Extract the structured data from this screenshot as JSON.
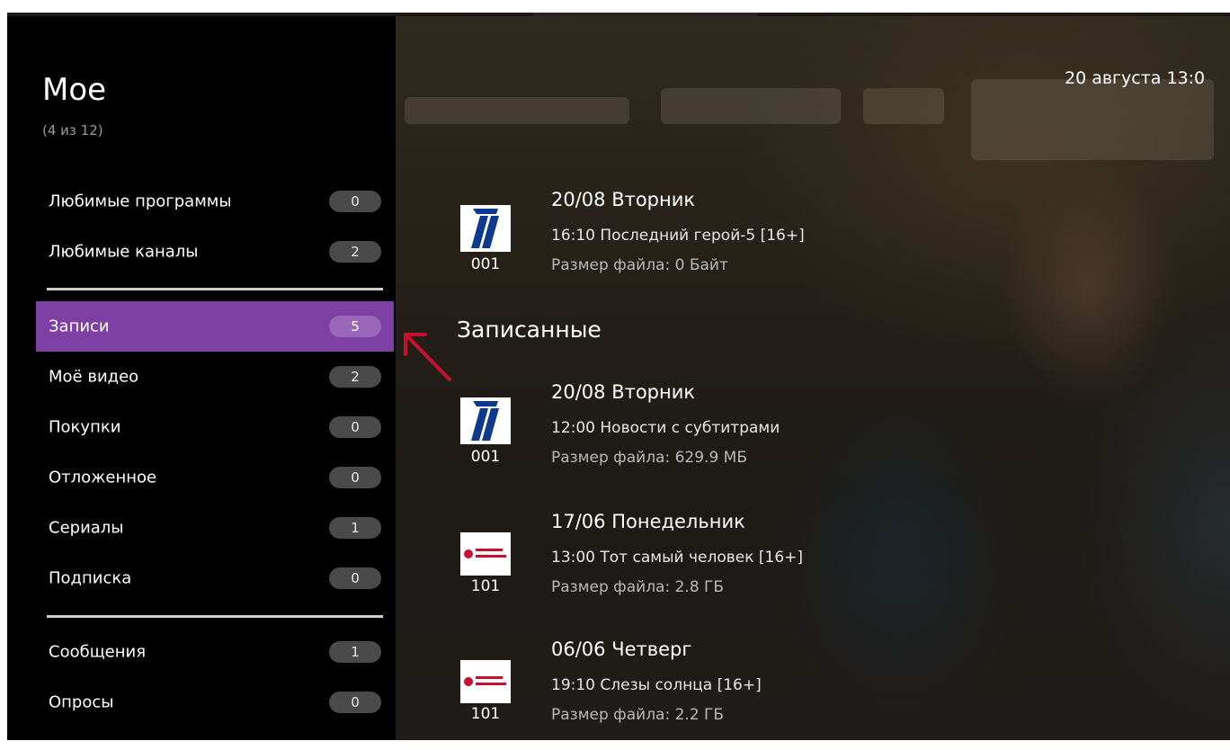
{
  "sidebar": {
    "title": "Мое",
    "count": "(4 из 12)",
    "items": [
      {
        "label": "Любимые программы",
        "count": "0"
      },
      {
        "label": "Любимые каналы",
        "count": "2"
      },
      {
        "label": "Записи",
        "count": "5",
        "active": true
      },
      {
        "label": "Моё видео",
        "count": "2"
      },
      {
        "label": "Покупки",
        "count": "0"
      },
      {
        "label": "Отложенное",
        "count": "0"
      },
      {
        "label": "Сериалы",
        "count": "1"
      },
      {
        "label": "Подписка",
        "count": "0"
      },
      {
        "label": "Сообщения",
        "count": "1"
      },
      {
        "label": "Опросы",
        "count": "0"
      }
    ]
  },
  "header": {
    "datetime": "20 августа 13:0"
  },
  "scheduled": {
    "channel": "001",
    "date": "20/08   Вторник",
    "program": "16:10  Последний герой-5 [16+]",
    "size": "Размер файла: 0 Байт"
  },
  "recorded": {
    "title": "Записанные",
    "items": [
      {
        "channel": "001",
        "logo": "channel-one-logo",
        "date": "20/08   Вторник",
        "program": "12:00  Новости с субтитрами",
        "size": "Размер файла: 629.9 МБ"
      },
      {
        "channel": "101",
        "logo": "red-channel-logo",
        "date": "17/06   Понедельник",
        "program": "13:00  Тот самый человек [16+]",
        "size": "Размер файла: 2.8 ГБ"
      },
      {
        "channel": "101",
        "logo": "red-channel-logo",
        "date": "06/06   Четверг",
        "program": "19:10  Слезы солнца [16+]",
        "size": "Размер файла: 2.2 ГБ"
      }
    ]
  },
  "colors": {
    "accent": "#7f40a6",
    "arrow": "#c8102e",
    "background": "#000000"
  }
}
